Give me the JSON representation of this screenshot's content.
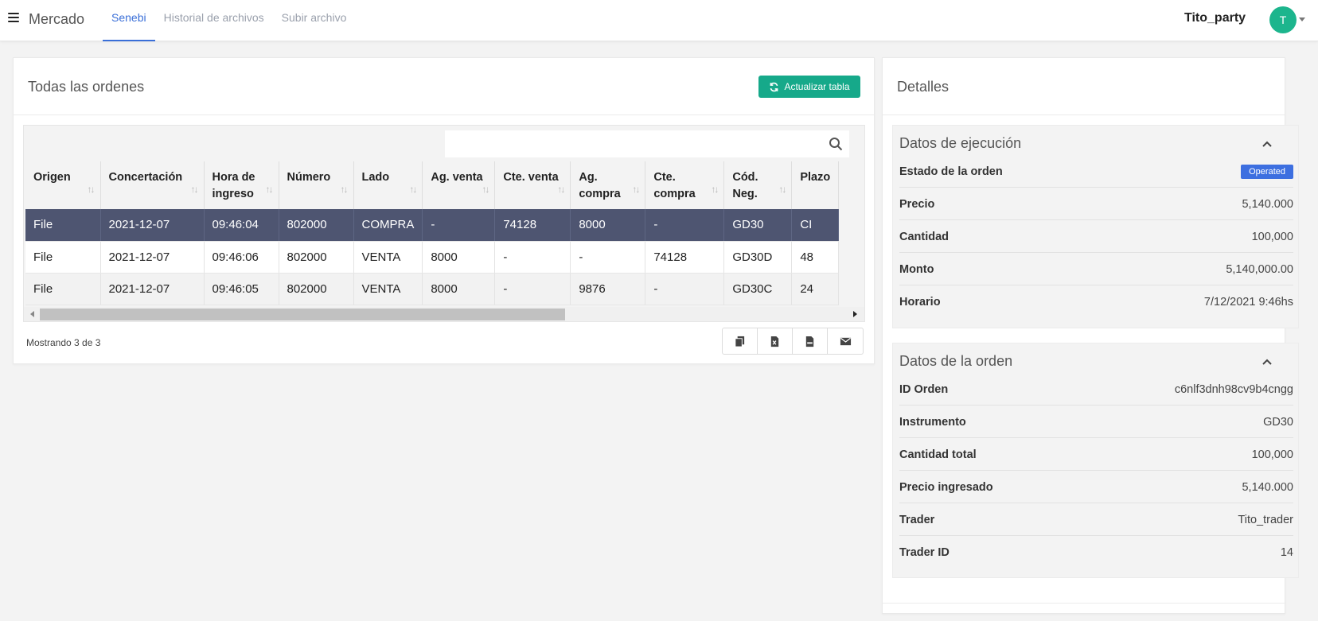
{
  "app": {
    "brand": "Mercado",
    "tabs": [
      {
        "label": "Senebi",
        "active": true
      },
      {
        "label": "Historial de archivos",
        "active": false
      },
      {
        "label": "Subir archivo",
        "active": false
      }
    ],
    "user": {
      "name": "Tito_party",
      "initial": "T"
    }
  },
  "colors": {
    "accent": "#3a6fd8",
    "button_green": "#16a98a",
    "avatar_green": "#1cb58d",
    "selected_row": "#4e5571",
    "badge_blue": "#3d6fe0"
  },
  "orders_panel": {
    "title": "Todas las ordenes",
    "refresh_label": "Actualizar tabla",
    "search_placeholder": "",
    "columns": [
      "Origen",
      "Concertación",
      "Hora de ingreso",
      "Número",
      "Lado",
      "Ag. venta",
      "Cte. venta",
      "Ag. compra",
      "Cte. compra",
      "Cód. Neg.",
      "Plazo"
    ],
    "rows": [
      [
        "File",
        "2021-12-07",
        "09:46:04",
        "802000",
        "COMPRA",
        "-",
        "74128",
        "8000",
        "-",
        "GD30",
        "CI"
      ],
      [
        "File",
        "2021-12-07",
        "09:46:06",
        "802000",
        "VENTA",
        "8000",
        "-",
        "-",
        "74128",
        "GD30D",
        "48"
      ],
      [
        "File",
        "2021-12-07",
        "09:46:05",
        "802000",
        "VENTA",
        "8000",
        "-",
        "9876",
        "-",
        "GD30C",
        "24"
      ]
    ],
    "selected_row": 0,
    "showing": "Mostrando 3 de 3",
    "export_icons": [
      "copy-icon",
      "excel-icon",
      "csv-icon",
      "email-icon"
    ]
  },
  "details_panel": {
    "title": "Detalles",
    "execution": {
      "title": "Datos de ejecución",
      "status_label": "Estado de la orden",
      "status_value": "Operated",
      "fields": [
        {
          "label": "Precio",
          "value": "5,140.000"
        },
        {
          "label": "Cantidad",
          "value": "100,000"
        },
        {
          "label": "Monto",
          "value": "5,140,000.00"
        },
        {
          "label": "Horario",
          "value": "7/12/2021 9:46hs"
        }
      ]
    },
    "order": {
      "title": "Datos de la orden",
      "fields": [
        {
          "label": "ID Orden",
          "value": "c6nlf3dnh98cv9b4cngg"
        },
        {
          "label": "Instrumento",
          "value": "GD30"
        },
        {
          "label": "Cantidad total",
          "value": "100,000"
        },
        {
          "label": "Precio ingresado",
          "value": "5,140.000"
        },
        {
          "label": "Trader",
          "value": "Tito_trader"
        },
        {
          "label": "Trader ID",
          "value": "14"
        }
      ]
    }
  }
}
